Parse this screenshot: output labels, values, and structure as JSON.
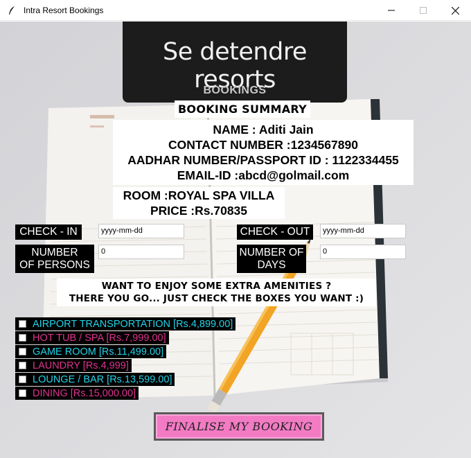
{
  "window": {
    "title": "Intra Resort Bookings"
  },
  "banner": {
    "title": "Se detendre resorts",
    "subtitle": "BOOKINGS"
  },
  "summary": {
    "heading": "BOOKING SUMMARY",
    "name": "NAME : Aditi Jain",
    "contact": "CONTACT NUMBER :1234567890",
    "id": "AADHAR NUMBER/PASSPORT ID : 1122334455",
    "email": "EMAIL-ID :abcd@golmail.com",
    "room": "ROOM :ROYAL SPA VILLA",
    "price": "PRICE :Rs.70835"
  },
  "form": {
    "checkin_label": "CHECK - IN",
    "checkin_value": "yyyy-mm-dd",
    "checkout_label": "CHECK - OUT",
    "checkout_value": "yyyy-mm-dd",
    "persons_label_1": "NUMBER",
    "persons_label_2": "OF PERSONS",
    "persons_value": "0",
    "days_label_1": "NUMBER OF",
    "days_label_2": "DAYS",
    "days_value": "0"
  },
  "amenities": {
    "heading_1": "WANT TO ENJOY SOME EXTRA AMENITIES ?",
    "heading_2": "THERE YOU GO... JUST CHECK THE BOXES YOU WANT :)",
    "items": [
      {
        "label": "AIRPORT TRANSPORTATION  [Rs.4,899.00]",
        "color": "#22d3e8",
        "checked": false
      },
      {
        "label": "HOT TUB / SPA  [Rs.7,999.00]",
        "color": "#e0338f",
        "checked": false
      },
      {
        "label": "GAME ROOM  [Rs.11,499.00]",
        "color": "#22d3e8",
        "checked": false
      },
      {
        "label": "LAUNDRY  [Rs.4,999]",
        "color": "#e0338f",
        "checked": false
      },
      {
        "label": "LOUNGE / BAR  [Rs.13,599.00]",
        "color": "#22d3e8",
        "checked": false
      },
      {
        "label": "DINING  [Rs.15,000.00]",
        "color": "#e0338f",
        "checked": false
      }
    ]
  },
  "actions": {
    "finalise_label": "FINALISE MY BOOKING"
  },
  "colors": {
    "accent_cyan": "#22d3e8",
    "accent_pink": "#e0338f",
    "button_pink": "#f27bc4",
    "banner_bg": "#1c1c1c"
  }
}
